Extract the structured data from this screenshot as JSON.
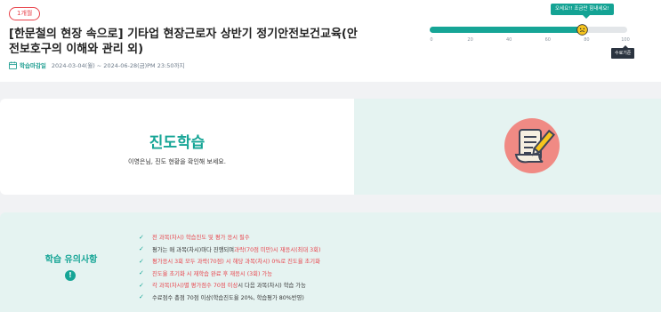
{
  "header": {
    "badge": "1개월",
    "title": "[한문철의 현장 속으로] 기타업 현장근로자 상반기 정기안전보건교육(안전보호구의 이해와 관리 외)",
    "period_label": "학습마감일",
    "period_value": "2024-03-04(월) ~ 2024-06-28(금)PM 23:50까지"
  },
  "progress": {
    "tooltip": "오세요!! 조금만 힘내세요!",
    "percent": 78,
    "ticks": [
      "0",
      "20",
      "40",
      "60",
      "80",
      "100"
    ],
    "complete_label": "수료기준",
    "accent": "#16a596"
  },
  "study": {
    "title": "진도학습",
    "subtitle": "이영은님, 진도 현황을 확인해 보세요.",
    "icon": "study-document-icon"
  },
  "notice": {
    "title": "학습 유의사항",
    "icon": "exclamation-icon",
    "items": [
      [
        {
          "t": "전 과목(차시) 학습진도 및 평가 응시 필수",
          "red": true
        }
      ],
      [
        {
          "t": "평가는 매 과목(차시)마다 진행되며 ",
          "red": false
        },
        {
          "t": "과락(70점 미만)시 재응시(최대 3회)",
          "red": true
        }
      ],
      [
        {
          "t": "평가응시 3회 모두 과락(70점) 시 해당 과목(차시) 0%로 진도율 초기화",
          "red": true
        }
      ],
      [
        {
          "t": "진도율 초기화 시 재학습 완료 후 재응시 (3회) 가능",
          "red": true
        }
      ],
      [
        {
          "t": "각 과목(차시)별 평가점수 70점 이상",
          "red": true
        },
        {
          "t": " 시 다음 과목(차시) 학습 가능",
          "red": false
        }
      ],
      [
        {
          "t": "수료점수 총점 70점 이상(학습진도율 20%, 학습평가 80%반영)",
          "red": false
        }
      ]
    ]
  }
}
